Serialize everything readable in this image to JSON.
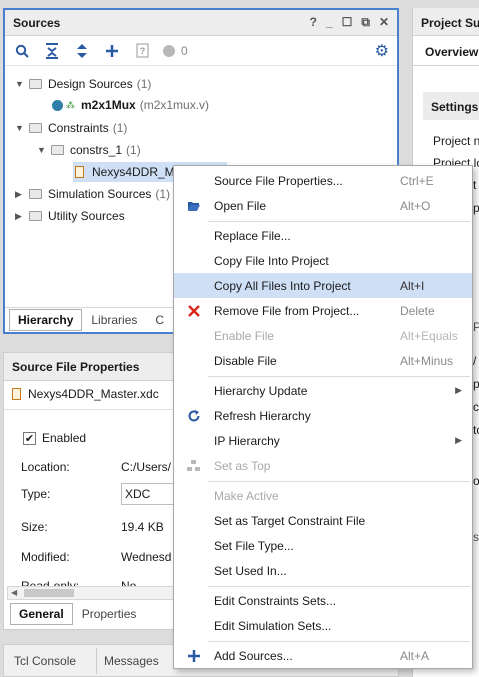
{
  "sources": {
    "title": "Sources",
    "title_icons": [
      "?",
      "_",
      "☐",
      "⧉",
      "✕"
    ],
    "gear": "⚙",
    "badge_count": "0",
    "tree": {
      "design_sources": {
        "label": "Design Sources",
        "count": "(1)"
      },
      "top_module": {
        "label": "m2x1Mux",
        "file": "(m2x1mux.v)"
      },
      "constraints": {
        "label": "Constraints",
        "count": "(1)"
      },
      "constrs": {
        "label": "constrs_1",
        "count": "(1)"
      },
      "xdc_file": {
        "label": "Nexys4DDR_M"
      },
      "simulation_sources": {
        "label": "Simulation Sources",
        "count": "(1)"
      },
      "utility_sources": {
        "label": "Utility Sources"
      }
    },
    "tabs": [
      "Hierarchy",
      "Libraries",
      "C"
    ]
  },
  "source_file_properties": {
    "title": "Source File Properties",
    "file_name": "Nexys4DDR_Master.xdc",
    "enabled_label": "Enabled",
    "rows": [
      {
        "key": "Location:",
        "value": "C:/Users/"
      },
      {
        "key": "Type:",
        "value": "XDC"
      },
      {
        "key": "Size:",
        "value": "19.4 KB"
      },
      {
        "key": "Modified:",
        "value": "Wednesd"
      },
      {
        "key": "Read-only:",
        "value": "No"
      }
    ],
    "tabs": [
      "General",
      "Properties"
    ]
  },
  "bottom_tabs": [
    "Tcl Console",
    "Messages"
  ],
  "project_summary": {
    "title": "Project Su",
    "overview": "Overview",
    "settings": "Settings",
    "lines": [
      "Project n",
      "Project lo",
      "t f",
      "p",
      "",
      "",
      "",
      "",
      "Pa",
      "",
      "/",
      "pa",
      "ct",
      "to",
      "",
      "ov",
      "",
      "",
      "si"
    ]
  },
  "context_menu": {
    "items": [
      {
        "label": "Source File Properties...",
        "shortcut": "Ctrl+E",
        "icon": "",
        "disabled": false
      },
      {
        "label": "Open File",
        "shortcut": "Alt+O",
        "icon": "folder-open",
        "disabled": false
      },
      {
        "label": "Replace File...",
        "shortcut": "",
        "icon": "",
        "disabled": false
      },
      {
        "label": "Copy File Into Project",
        "shortcut": "",
        "icon": "",
        "disabled": false
      },
      {
        "label": "Copy All Files Into Project",
        "shortcut": "Alt+I",
        "icon": "",
        "disabled": false,
        "highlighted": true
      },
      {
        "label": "Remove File from Project...",
        "shortcut": "Delete",
        "icon": "red-x",
        "disabled": false
      },
      {
        "label": "Enable File",
        "shortcut": "Alt+Equals",
        "icon": "",
        "disabled": true
      },
      {
        "label": "Disable File",
        "shortcut": "Alt+Minus",
        "icon": "",
        "disabled": false
      },
      {
        "label": "Hierarchy Update",
        "shortcut": "",
        "icon": "",
        "disabled": false,
        "submenu": true
      },
      {
        "label": "Refresh Hierarchy",
        "shortcut": "",
        "icon": "refresh",
        "disabled": false
      },
      {
        "label": "IP Hierarchy",
        "shortcut": "",
        "icon": "",
        "disabled": false,
        "submenu": true
      },
      {
        "label": "Set as Top",
        "shortcut": "",
        "icon": "hierarchy",
        "disabled": true
      },
      {
        "label": "Make Active",
        "shortcut": "",
        "icon": "",
        "disabled": true
      },
      {
        "label": "Set as Target Constraint File",
        "shortcut": "",
        "icon": "",
        "disabled": false
      },
      {
        "label": "Set File Type...",
        "shortcut": "",
        "icon": "",
        "disabled": false
      },
      {
        "label": "Set Used In...",
        "shortcut": "",
        "icon": "",
        "disabled": false
      },
      {
        "label": "Edit Constraints Sets...",
        "shortcut": "",
        "icon": "",
        "disabled": false
      },
      {
        "label": "Edit Simulation Sets...",
        "shortcut": "",
        "icon": "",
        "disabled": false
      },
      {
        "label": "Add Sources...",
        "shortcut": "Alt+A",
        "icon": "plus",
        "disabled": false
      }
    ]
  },
  "colors": {
    "accent": "#4a7fd0",
    "highlight": "#cfe0f6",
    "delete_red": "#d9261c"
  }
}
